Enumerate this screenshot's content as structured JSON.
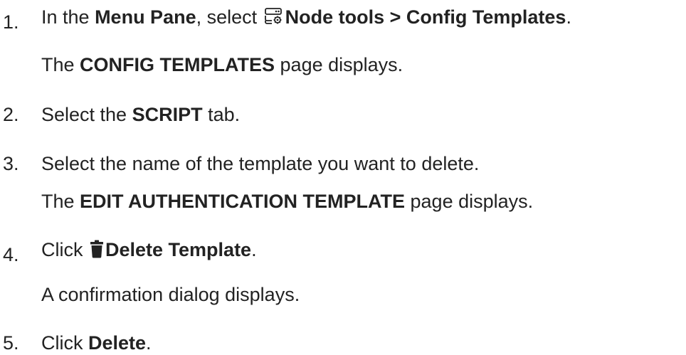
{
  "steps": [
    {
      "number": "1.",
      "instruction": {
        "prefix": "In the ",
        "menu_pane": "Menu Pane",
        "mid": ", select ",
        "icon": "node-tools-icon",
        "path": "Node tools > Config Templates",
        "suffix": "."
      },
      "result": {
        "prefix": "The ",
        "page": "CONFIG TEMPLATES",
        "suffix": " page displays."
      }
    },
    {
      "number": "2.",
      "instruction": {
        "prefix": "Select the ",
        "tab": "SCRIPT",
        "suffix": " tab."
      }
    },
    {
      "number": "3.",
      "instruction": {
        "text": "Select the name of the template you want to delete."
      },
      "result": {
        "prefix": "The ",
        "page": "EDIT AUTHENTICATION TEMPLATE",
        "suffix": " page displays."
      }
    },
    {
      "number": "4.",
      "instruction": {
        "prefix": "Click ",
        "icon": "trash-icon",
        "button": "Delete Template",
        "suffix": "."
      },
      "result": {
        "text": "A confirmation dialog displays."
      }
    },
    {
      "number": "5.",
      "instruction": {
        "prefix": "Click ",
        "button": "Delete",
        "suffix": "."
      }
    }
  ]
}
